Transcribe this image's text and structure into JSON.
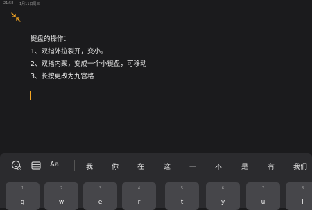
{
  "status": {
    "time": "21:58",
    "date": "1月11日周三"
  },
  "note": {
    "lines": [
      "键盘的操作：",
      "1、双指外拉裂开，变小。",
      "2、双指内聚，变成一个小键盘，可移动",
      "3、长按更改为九宫格"
    ]
  },
  "keyboard": {
    "toolbar": {
      "icons": [
        "emoji-settings-icon",
        "table-icon"
      ],
      "font_label": "Aa"
    },
    "candidates": [
      "我",
      "你",
      "在",
      "这",
      "一",
      "不",
      "是",
      "有",
      "我们"
    ],
    "keys": [
      {
        "num": "1",
        "letter": "q"
      },
      {
        "num": "2",
        "letter": "w"
      },
      {
        "num": "3",
        "letter": "e"
      },
      {
        "num": "4",
        "letter": "r"
      },
      {
        "num": "5",
        "letter": "t"
      },
      {
        "num": "6",
        "letter": "y"
      },
      {
        "num": "7",
        "letter": "u"
      },
      {
        "num": "8",
        "letter": "i"
      }
    ]
  },
  "colors": {
    "accent": "#f5a623",
    "background": "#1b1b1d",
    "key": "#46464a"
  }
}
